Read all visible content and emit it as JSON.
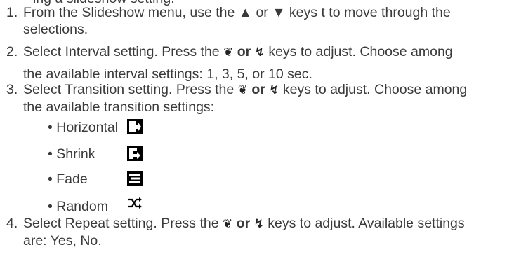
{
  "cutline": "ing a slideshow setting.",
  "steps": [
    {
      "num": "1.",
      "line1": "From the Slideshow menu, use the ▲ or ▼ keys t to move through the",
      "line2": "selections."
    },
    {
      "num": "2.",
      "line1_a": "Select Interval setting. Press the ",
      "line1_b": " keys to adjust. Choose among",
      "line2": "the available interval settings: 1, 3, 5, or 10 sec."
    },
    {
      "num": "3.",
      "line1_a": "Select Transition setting. Press the ",
      "line1_b": " keys to adjust. Choose among",
      "line2": "the available transition settings:",
      "transitions": [
        {
          "label": "• Horizontal",
          "icon": "horizontal-transition-icon"
        },
        {
          "label": "• Shrink",
          "icon": "shrink-transition-icon"
        },
        {
          "label": "• Fade",
          "icon": "fade-transition-icon"
        },
        {
          "label": "• Random",
          "icon": "random-transition-icon"
        }
      ]
    },
    {
      "num": "4.",
      "line1_a": "Select Repeat setting. Press the ",
      "line1_b": " keys to adjust. Available settings",
      "line2": "are: Yes, No."
    }
  ],
  "keys": {
    "macro_glyph": "❦",
    "or_text": " or ",
    "flash_glyph": "↯"
  }
}
